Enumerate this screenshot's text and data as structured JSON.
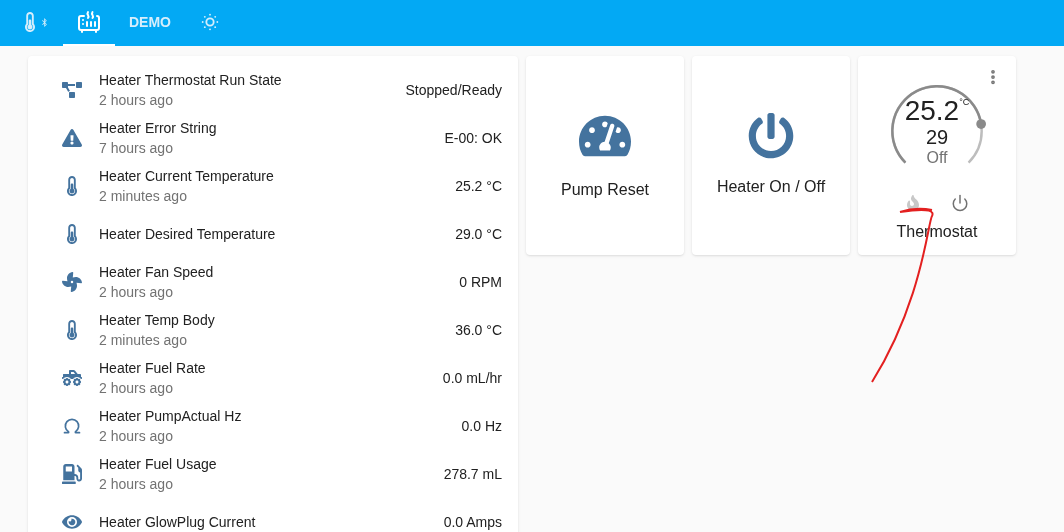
{
  "tabs": [
    {
      "kind": "icon",
      "selected": false
    },
    {
      "kind": "icon",
      "selected": true
    },
    {
      "kind": "text",
      "label": "DEMO",
      "selected": false
    },
    {
      "kind": "icon",
      "selected": false
    }
  ],
  "entities": [
    {
      "name": "Heater Thermostat Run State",
      "updated": "2 hours ago",
      "value": "Stopped/Ready"
    },
    {
      "name": "Heater Error String",
      "updated": "7 hours ago",
      "value": "E-00: OK"
    },
    {
      "name": "Heater Current Temperature",
      "updated": "2 minutes ago",
      "value": "25.2 °C"
    },
    {
      "name": "Heater Desired Temperature",
      "value": "29.0 °C"
    },
    {
      "name": "Heater Fan Speed",
      "updated": "2 hours ago",
      "value": "0 RPM"
    },
    {
      "name": "Heater Temp Body",
      "updated": "2 minutes ago",
      "value": "36.0 °C"
    },
    {
      "name": "Heater Fuel Rate",
      "updated": "2 hours ago",
      "value": "0.0 mL/hr"
    },
    {
      "name": "Heater PumpActual Hz",
      "updated": "2 hours ago",
      "value": "0.0 Hz"
    },
    {
      "name": "Heater Fuel Usage",
      "updated": "2 hours ago",
      "value": "278.7 mL"
    },
    {
      "name": "Heater GlowPlug Current",
      "value": "0.0 Amps"
    }
  ],
  "buttons": [
    {
      "label": "Pump Reset"
    },
    {
      "label": "Heater On / Off"
    }
  ],
  "thermostat": {
    "current": "25.2",
    "unit": "°C",
    "target": "29",
    "state": "Off",
    "level": 0.8,
    "name": "Thermostat",
    "modes": [
      {
        "kind": "heat",
        "selected": false
      },
      {
        "kind": "off",
        "selected": true
      }
    ]
  }
}
